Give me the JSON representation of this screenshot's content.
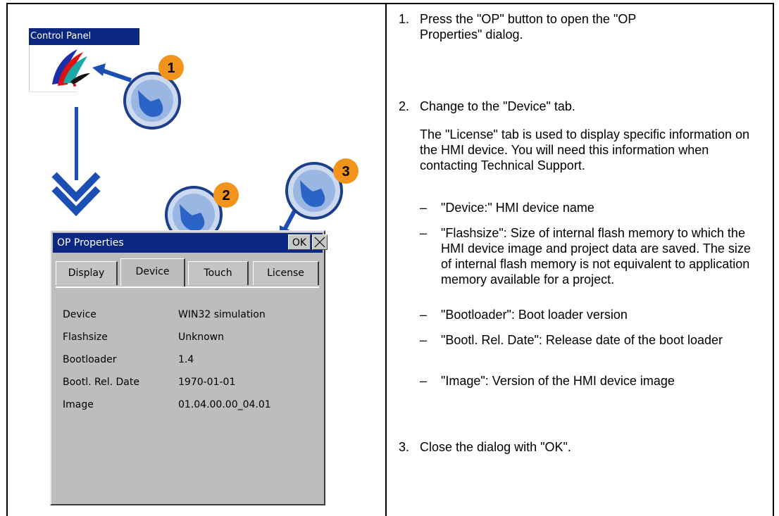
{
  "control_panel": {
    "title": "Control Panel"
  },
  "callouts": [
    "1",
    "2",
    "3"
  ],
  "op_dialog": {
    "title": "OP Properties",
    "ok_label": "OK",
    "tabs": [
      "Display",
      "Device",
      "Touch",
      "License"
    ],
    "active_tab": "Device",
    "properties": [
      {
        "label": "Device",
        "value": "WIN32 simulation"
      },
      {
        "label": "Flashsize",
        "value": "Unknown"
      },
      {
        "label": "Bootloader",
        "value": "1.4"
      },
      {
        "label": "Bootl. Rel. Date",
        "value": "1970-01-01"
      },
      {
        "label": "Image",
        "value": "01.04.00.00_04.01"
      }
    ]
  },
  "instructions": {
    "step1": {
      "num": "1.",
      "text": "Press the \"OP\" button to open the \"OP Properties\" dialog."
    },
    "step2": {
      "num": "2.",
      "text": "Change to the \"Device\" tab."
    },
    "step2_note": "The \"License\" tab is used to display specific information on the HMI device. You will need this information when contacting Technical Support.",
    "bullets": [
      "\"Device:\" HMI device name",
      "\"Flashsize\": Size of internal flash memory to which the HMI device image and project data are saved. The size of internal flash memory is not equivalent to application memory available for a project.",
      "\"Bootloader\": Boot loader version",
      "\"Bootl. Rel. Date\": Release date of the boot loader",
      "\"Image\": Version of the HMI device image"
    ],
    "bullet_dash": "–",
    "step3": {
      "num": "3.",
      "text": "Close the dialog with \"OK\"."
    }
  }
}
